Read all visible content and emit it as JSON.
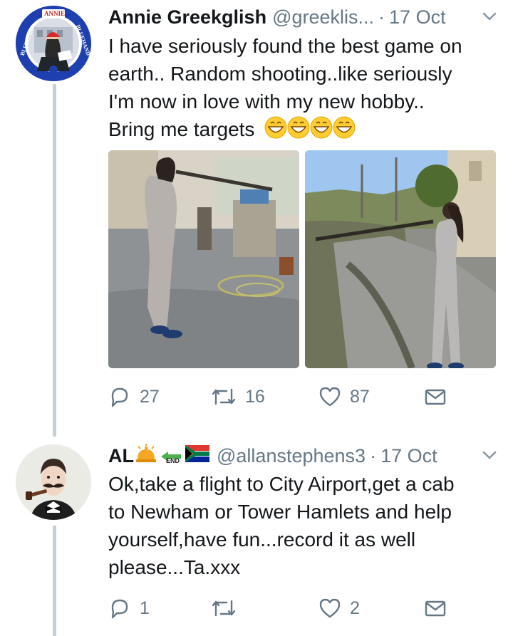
{
  "tweets": [
    {
      "name": "Annie Greekglish",
      "handle": "@greeklis...",
      "separator": "·",
      "time": "17 Oct",
      "text_line1": "I have seriously found the best game on",
      "text_line2": "earth.. Random shooting..like seriously",
      "text_line3": "I'm now in love with my new hobby..",
      "text_line4": "Bring me targets",
      "avatar_badge_text": "ANNIE",
      "avatar_ring_text_left": "BLUEHAND",
      "avatar_ring_text_right": "BLUEHAND",
      "emoji": [
        "grinning-face-icon",
        "grinning-face-icon",
        "grinning-face-icon",
        "grinning-face-icon"
      ],
      "replies": "27",
      "retweets": "16",
      "likes": "87"
    },
    {
      "name": "AL",
      "handle": "@allanstephens3",
      "separator": "·",
      "time": "17 Oct",
      "name_emoji": [
        "bellhop-bell-icon",
        "end-arrow-icon",
        "south-africa-flag-icon"
      ],
      "end_label": "END",
      "text_line1": "Ok,take a flight to City Airport,get a cab",
      "text_line2": "to Newham or Tower Hamlets and help",
      "text_line3": "yourself,have fun...record it as well",
      "text_line4": "please...Ta.xxx",
      "replies": "1",
      "retweets": "",
      "likes": "2"
    }
  ],
  "colors": {
    "text": "#14171a",
    "muted": "#657786",
    "thread": "#c4cfd6",
    "avatar_ring": "#1d3fb0"
  }
}
